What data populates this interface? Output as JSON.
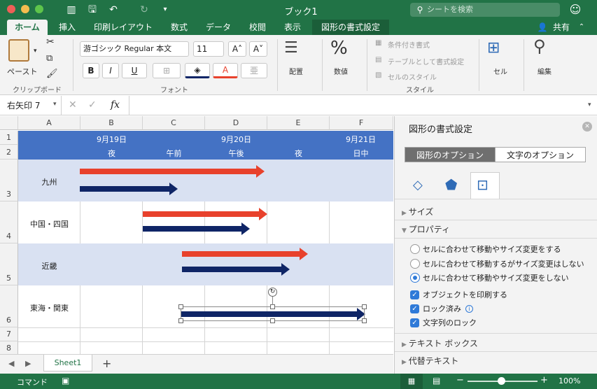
{
  "window": {
    "title": "ブック1",
    "search_placeholder": "シートを検索"
  },
  "tabs": [
    "ホーム",
    "挿入",
    "印刷レイアウト",
    "数式",
    "データ",
    "校閲",
    "表示",
    "図形の書式設定"
  ],
  "share_label": "共有",
  "ribbon": {
    "paste_label": "ペースト",
    "clipboard_label": "クリップボード",
    "font_name": "游ゴシック Regular 本文",
    "font_size": "11",
    "font_label": "フォント",
    "bold": "B",
    "italic": "I",
    "underline": "U",
    "align_label": "配置",
    "number_label": "数値",
    "cond_format": "条件付き書式",
    "table_format": "テーブルとして書式設定",
    "cell_style": "セルのスタイル",
    "style_label": "スタイル",
    "cells_label": "セル",
    "edit_label": "編集"
  },
  "formula": {
    "namebox": "右矢印 7",
    "fx": "fx",
    "value": ""
  },
  "grid": {
    "columns": [
      "A",
      "B",
      "C",
      "D",
      "E",
      "F"
    ],
    "rows": [
      "1",
      "2",
      "3",
      "4",
      "5",
      "6",
      "7",
      "8"
    ],
    "dates": [
      "9月19日",
      "9月20日",
      "9月21日"
    ],
    "periods": [
      "夜",
      "午前",
      "午後",
      "夜",
      "日中"
    ],
    "regions": [
      "九州",
      "中国・四国",
      "近畿",
      "東海・関東"
    ]
  },
  "sheet": {
    "tab": "Sheet1",
    "add": "+"
  },
  "status": {
    "mode": "コマンド",
    "zoom": "100%"
  },
  "pane": {
    "title": "図形の書式設定",
    "seg_shape": "図形のオプション",
    "seg_text": "文字のオプション",
    "size": "サイズ",
    "properties": "プロパティ",
    "radio1": "セルに合わせて移動やサイズ変更をする",
    "radio2": "セルに合わせて移動するがサイズ変更はしない",
    "radio3": "セルに合わせて移動やサイズ変更をしない",
    "print": "オブジェクトを印刷する",
    "locked": "ロック済み",
    "text_lock": "文字列のロック",
    "textbox": "テキスト ボックス",
    "alt_text": "代替テキスト"
  },
  "colors": {
    "accent": "#217346",
    "header_band": "#4472c4",
    "row_band": "#d9e1f2",
    "arrow_red": "#e8412c",
    "arrow_navy": "#0f2566"
  }
}
